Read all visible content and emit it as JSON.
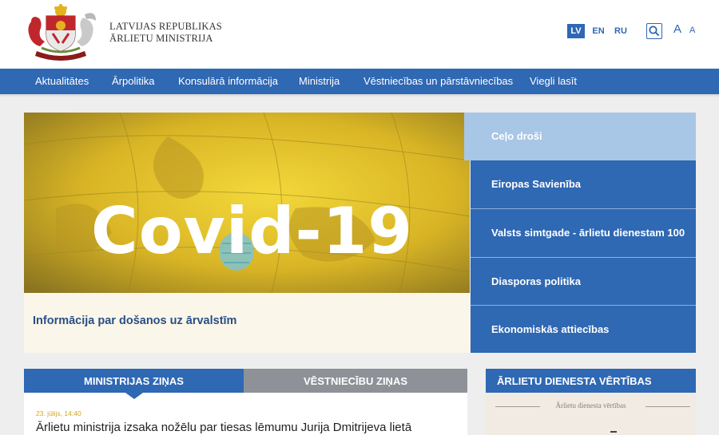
{
  "header": {
    "brand_line1": "LATVIJAS REPUBLIKAS",
    "brand_line2": "ĀRLIETU MINISTRIJA",
    "logo_icon": "coat-of-arms-icon",
    "languages": [
      {
        "label": "LV",
        "active": true
      },
      {
        "label": "EN",
        "active": false
      },
      {
        "label": "RU",
        "active": false
      }
    ],
    "search_icon": "search-icon",
    "font_large_label": "A",
    "font_small_label": "A"
  },
  "nav": {
    "items": [
      "Aktualitātes",
      "Ārpolitika",
      "Konsulārā informācija",
      "Ministrija",
      "Vēstniecības un pārstāvniecības",
      "Viegli lasīt"
    ]
  },
  "hero": {
    "image_text": "Covid-19",
    "caption": "Informācija par došanos uz ārvalstīm"
  },
  "side_menu": {
    "items": [
      "Ceļo droši",
      "Eiropas Savienība",
      "Valsts simtgade - ārlietu dienestam 100",
      "Diasporas politika",
      "Ekonomiskās attiecības"
    ]
  },
  "news": {
    "tab_ministry": "MINISTRIJAS ZIŅAS",
    "tab_embassy": "VĒSTNIECĪBU ZIŅAS",
    "date": "23. jūlijs, 14:40",
    "title": "Ārlietu ministrija izsaka nožēlu par tiesas lēmumu Jurija Dmitrijeva lietā"
  },
  "values": {
    "heading": "ĀRLIETU DIENESTA VĒRTĪBAS",
    "image_caption": "Ārlietu dienesta vērtības"
  },
  "colors": {
    "primary_blue": "#2f68b3",
    "light_blue": "#a8c6e6",
    "grey_tab": "#8e9298",
    "hero_yellow": "#e8c52a"
  }
}
